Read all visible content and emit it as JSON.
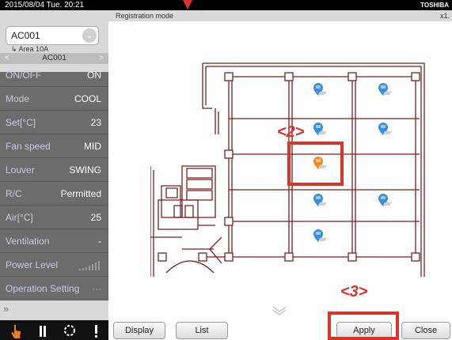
{
  "status_bar": {
    "datetime": "2015/08/04 Tue. 20:21",
    "brand": "TOSHIBA"
  },
  "sidebar": {
    "unit": "AC001",
    "area": "Area 10A",
    "nav_unit": "AC001",
    "nav_prev": "<",
    "nav_next": ">",
    "rows": [
      {
        "label": "ON/OFF",
        "value": "ON"
      },
      {
        "label": "Mode",
        "value": "COOL"
      },
      {
        "label": "Set[°C]",
        "value": "23"
      },
      {
        "label": "Fan speed",
        "value": "MID"
      },
      {
        "label": "Louver",
        "value": "SWING"
      },
      {
        "label": "R/C",
        "value": "Permitted"
      },
      {
        "label": "Air[°C]",
        "value": "25"
      },
      {
        "label": "Ventilation",
        "value": "-"
      },
      {
        "label": "Power Level",
        "value": ""
      },
      {
        "label": "Operation Setting",
        "value": "···"
      }
    ],
    "collapse_glyph": "»"
  },
  "header": {
    "mode": "Registration mode",
    "zoom": "x1."
  },
  "callouts": {
    "marker": "<2>",
    "apply": "<3>"
  },
  "buttons": {
    "display": "Display",
    "list": "List",
    "apply": "Apply",
    "close": "Close"
  },
  "colors": {
    "accent_red": "#d9332a",
    "marker_blue": "#3a8fdc",
    "marker_orange": "#f08a24",
    "wall": "#7a1f1f",
    "sidebar_bg": "#6c6c6c"
  },
  "icons": [
    "hand-icon",
    "pause-icon",
    "gear-icon",
    "alert-icon",
    "chevron-down-icon"
  ]
}
